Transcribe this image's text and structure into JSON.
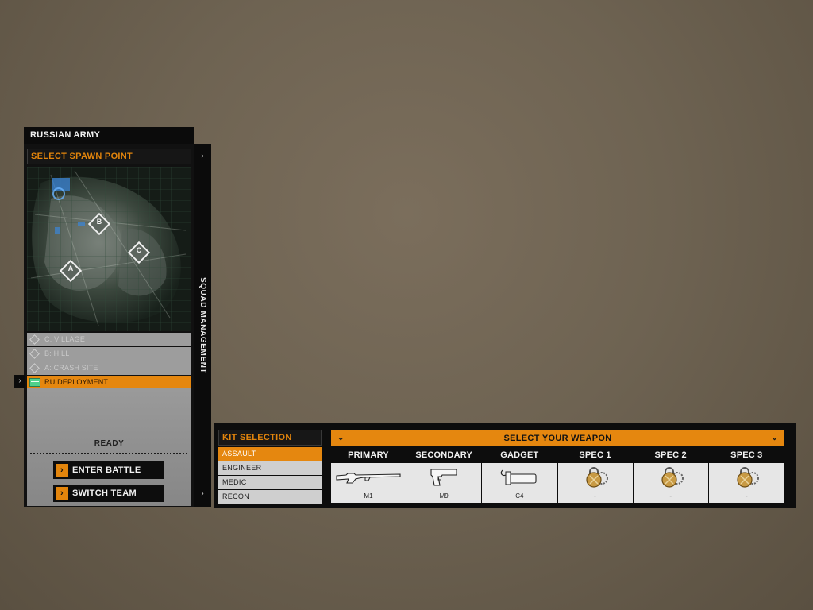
{
  "team": {
    "name": "RUSSIAN ARMY"
  },
  "spawn": {
    "header": "SELECT SPAWN POINT",
    "points": [
      {
        "label": "C: VILLAGE",
        "selected": false,
        "icon": "flag-diamond-icon"
      },
      {
        "label": "B: HILL",
        "selected": false,
        "icon": "flag-diamond-icon"
      },
      {
        "label": "A: CRASH SITE",
        "selected": false,
        "icon": "flag-diamond-icon"
      },
      {
        "label": "RU DEPLOYMENT",
        "selected": true,
        "icon": "deployment-icon"
      }
    ],
    "map_markers": [
      "C",
      "B",
      "A"
    ]
  },
  "status": {
    "ready": "READY"
  },
  "buttons": {
    "enter_battle": "ENTER BATTLE",
    "switch_team": "SWITCH TEAM"
  },
  "squad": {
    "label": "SQUAD MANAGEMENT"
  },
  "kits": {
    "header": "KIT SELECTION",
    "items": [
      {
        "label": "ASSAULT",
        "selected": true
      },
      {
        "label": "ENGINEER",
        "selected": false
      },
      {
        "label": "MEDIC",
        "selected": false
      },
      {
        "label": "RECON",
        "selected": false
      }
    ]
  },
  "weapons": {
    "header": "SELECT YOUR WEAPON",
    "slots": [
      {
        "title": "PRIMARY",
        "item": "M1",
        "icon": "rifle-icon"
      },
      {
        "title": "SECONDARY",
        "item": "M9",
        "icon": "pistol-icon"
      },
      {
        "title": "GADGET",
        "item": "C4",
        "icon": "c4-explosive-icon"
      },
      {
        "title": "SPEC 1",
        "item": "-",
        "icon": "locked-spec-icon"
      },
      {
        "title": "SPEC 2",
        "item": "-",
        "icon": "locked-spec-icon"
      },
      {
        "title": "SPEC 3",
        "item": "-",
        "icon": "locked-spec-icon"
      }
    ]
  },
  "colors": {
    "accent": "#e5870f",
    "panel": "#0d0d0d",
    "list_bg": "#9d9d9d"
  }
}
